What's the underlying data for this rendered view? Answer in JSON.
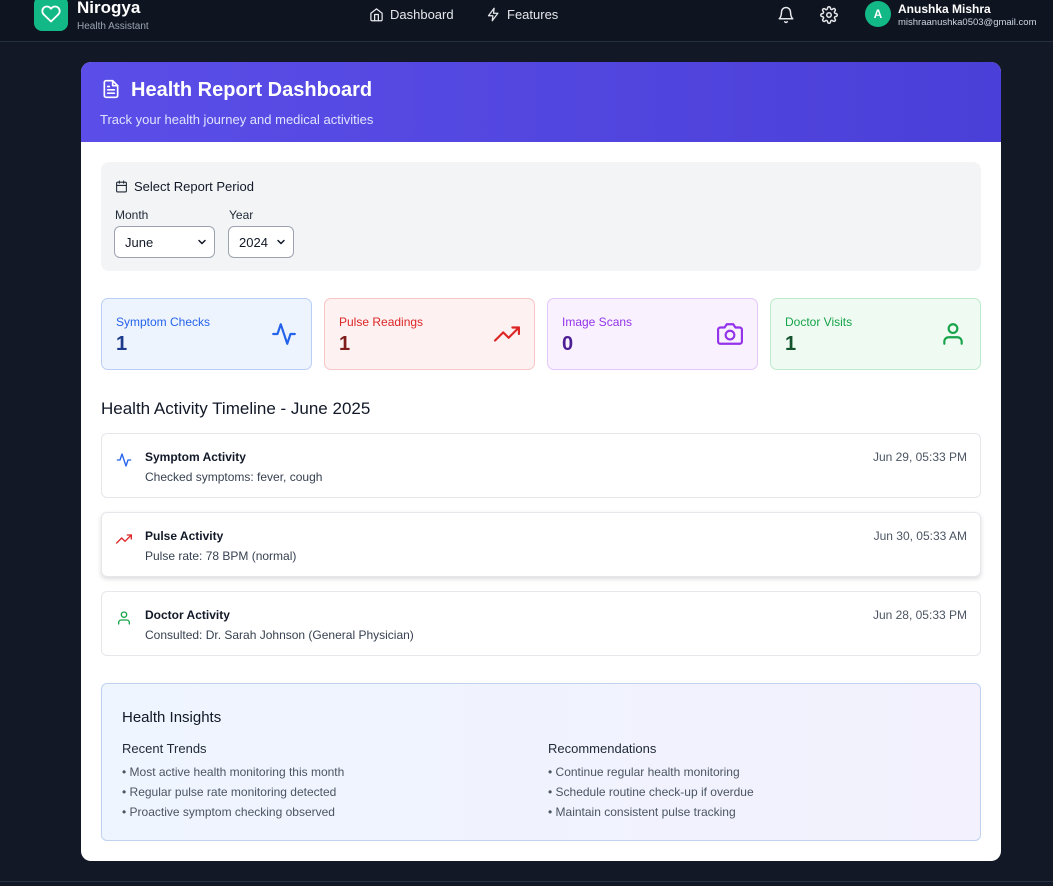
{
  "nav": {
    "brand_name": "Nirogya",
    "brand_sub": "Health Assistant",
    "links": [
      {
        "label": "Dashboard",
        "icon": "home-icon"
      },
      {
        "label": "Features",
        "icon": "bolt-icon"
      }
    ],
    "user": {
      "initial": "A",
      "name": "Anushka Mishra",
      "email": "mishraanushka0503@gmail.com"
    }
  },
  "header": {
    "title": "Health Report Dashboard",
    "subtitle": "Track your health journey and medical activities"
  },
  "period": {
    "title": "Select Report Period",
    "month_label": "Month",
    "month_value": "June",
    "year_label": "Year",
    "year_value": "2024"
  },
  "stats": [
    {
      "label": "Symptom Checks",
      "value": "1",
      "icon": "activity-icon",
      "color": "#2563eb"
    },
    {
      "label": "Pulse Readings",
      "value": "1",
      "icon": "trending-up-icon",
      "color": "#dc2626"
    },
    {
      "label": "Image Scans",
      "value": "0",
      "icon": "camera-icon",
      "color": "#9333ea"
    },
    {
      "label": "Doctor Visits",
      "value": "1",
      "icon": "user-icon",
      "color": "#16a34a"
    }
  ],
  "timeline": {
    "title": "Health Activity Timeline - June 2025",
    "items": [
      {
        "title": "Symptom Activity",
        "desc": "Checked symptoms: fever, cough",
        "time": "Jun 29, 05:33 PM",
        "icon": "activity-icon"
      },
      {
        "title": "Pulse Activity",
        "desc": "Pulse rate: 78 BPM (normal)",
        "time": "Jun 30, 05:33 AM",
        "icon": "trending-up-icon"
      },
      {
        "title": "Doctor Activity",
        "desc": "Consulted: Dr. Sarah Johnson (General Physician)",
        "time": "Jun 28, 05:33 PM",
        "icon": "user-icon"
      }
    ]
  },
  "insights": {
    "title": "Health Insights",
    "trends_title": "Recent Trends",
    "trends": [
      "• Most active health monitoring this month",
      "• Regular pulse rate monitoring detected",
      "• Proactive symptom checking observed"
    ],
    "recs_title": "Recommendations",
    "recs": [
      "• Continue regular health monitoring",
      "• Schedule routine check-up if overdue",
      "• Maintain consistent pulse tracking"
    ]
  }
}
